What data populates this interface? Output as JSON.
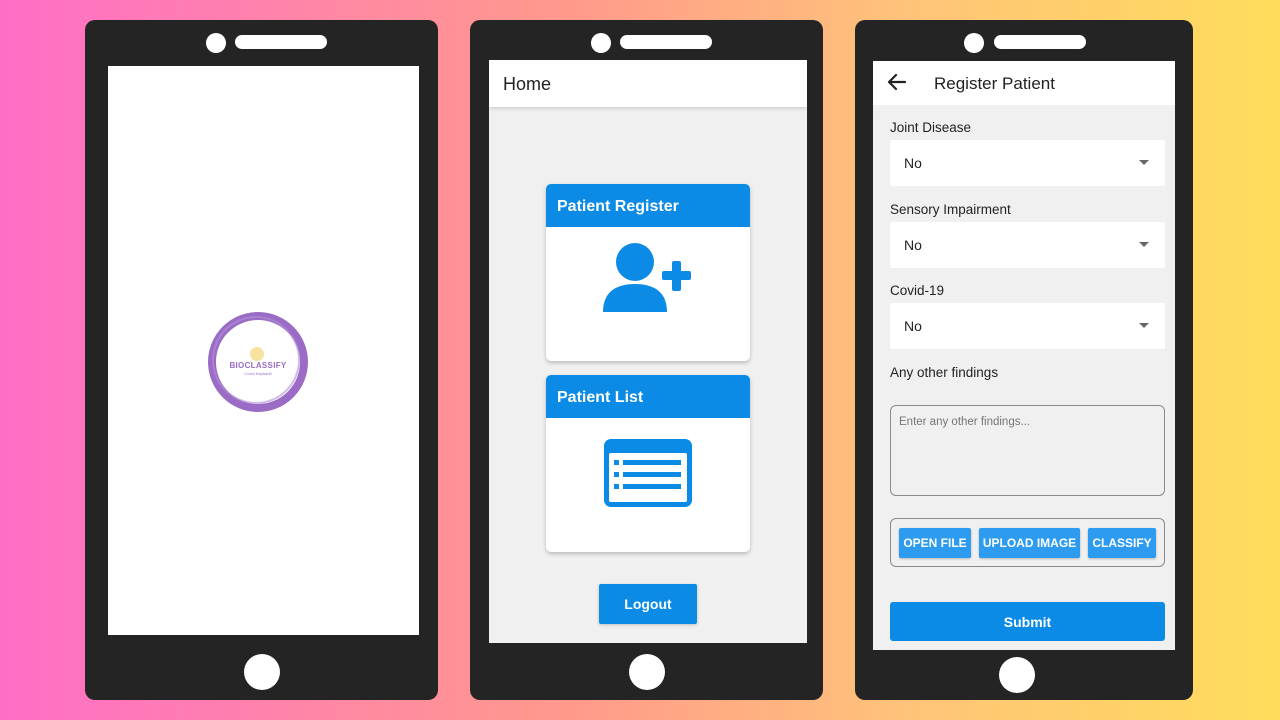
{
  "colors": {
    "accent": "#0b8be5",
    "phone_frame": "#242424",
    "screen_bg": "#f0f0f0",
    "logo_purple": "#9b6cc6"
  },
  "splash": {
    "logo_text": "BioClassify",
    "logo_subtext": "Covid Kaphanit"
  },
  "home": {
    "title": "Home",
    "cards": [
      {
        "label": "Patient Register",
        "icon": "add-user-icon"
      },
      {
        "label": "Patient List",
        "icon": "list-icon"
      }
    ],
    "logout_label": "Logout"
  },
  "register": {
    "title": "Register Patient",
    "back_icon": "arrow-left-icon",
    "fields": [
      {
        "label": "Joint Disease",
        "value": "No"
      },
      {
        "label": "Sensory Impairment",
        "value": "No"
      },
      {
        "label": "Covid-19",
        "value": "No"
      }
    ],
    "findings": {
      "label": "Any other findings",
      "placeholder": "Enter any other findings..."
    },
    "actions": [
      "OPEN FILE",
      "UPLOAD IMAGE",
      "CLASSIFY"
    ],
    "submit_label": "Submit"
  }
}
